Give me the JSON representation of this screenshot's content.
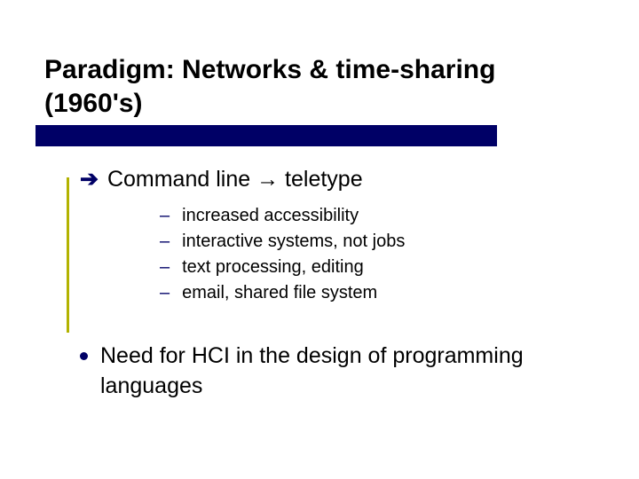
{
  "title": "Paradigm: Networks & time-sharing (1960's)",
  "main": {
    "prefix": "Command line",
    "arrow": "→",
    "suffix": "teletype"
  },
  "subs": [
    "increased accessibility",
    "interactive systems, not jobs",
    "text processing, editing",
    "email, shared file system"
  ],
  "bullet": "Need for HCI in the design of programming languages"
}
